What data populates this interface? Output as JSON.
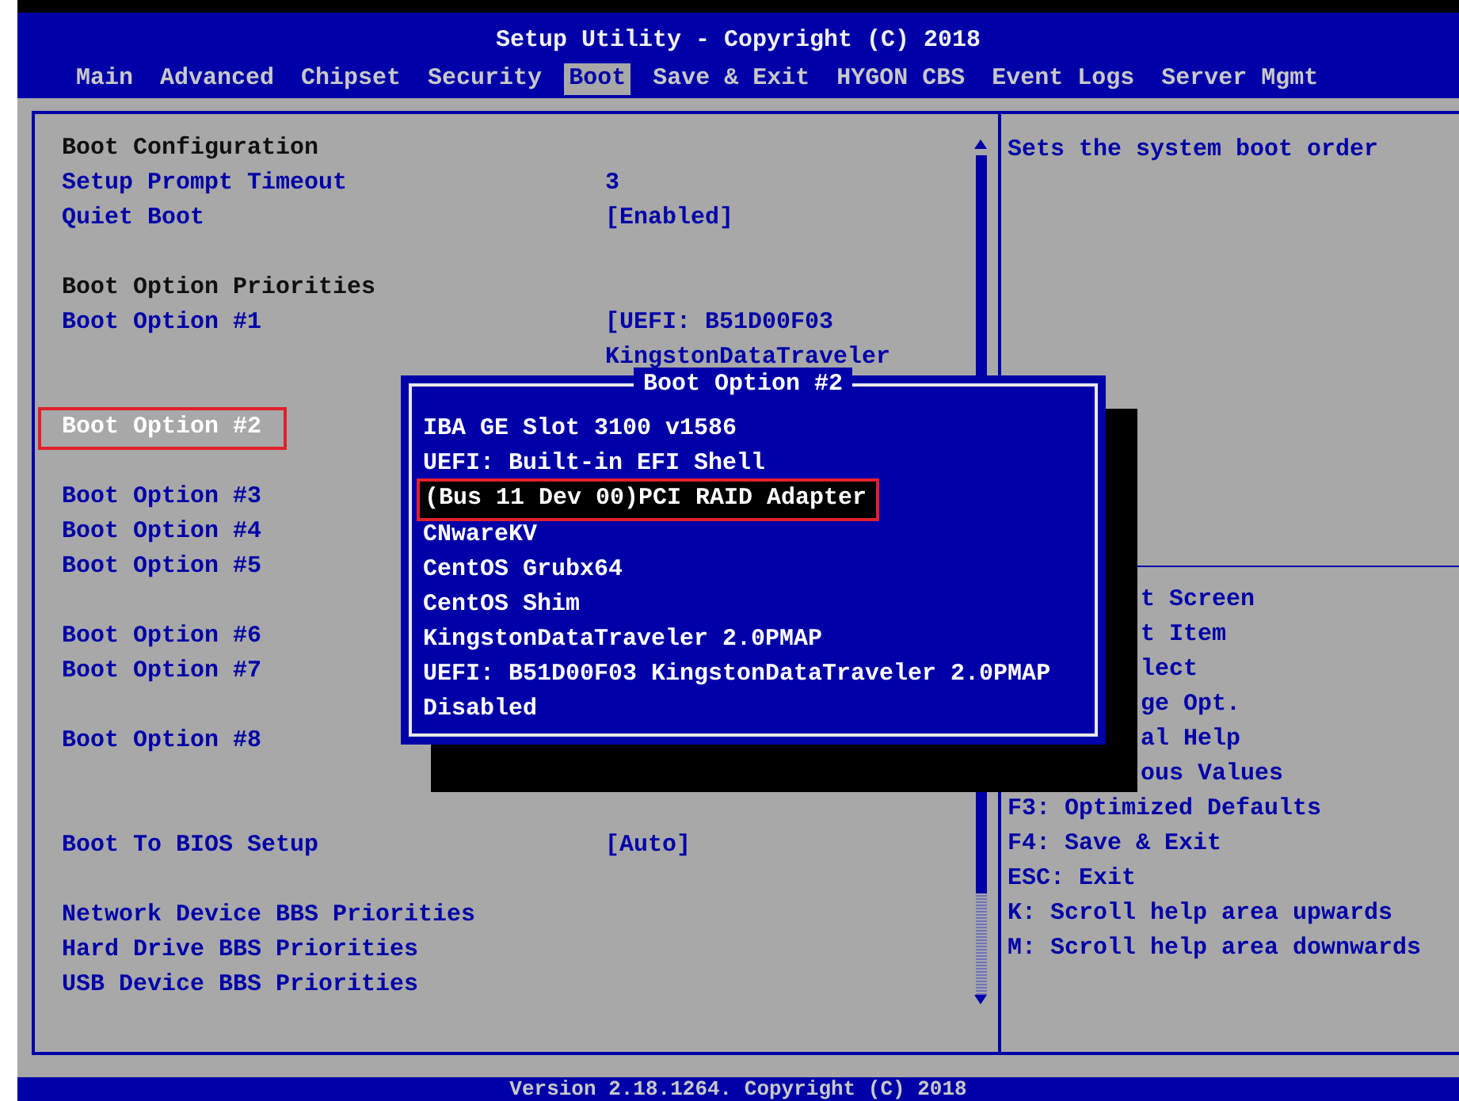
{
  "window": {
    "title": "Setup Utility - Copyright (C) 2018"
  },
  "tabs": [
    {
      "label": "Main",
      "selected": false
    },
    {
      "label": "Advanced",
      "selected": false
    },
    {
      "label": "Chipset",
      "selected": false
    },
    {
      "label": "Security",
      "selected": false
    },
    {
      "label": "Boot",
      "selected": true
    },
    {
      "label": "Save & Exit",
      "selected": false
    },
    {
      "label": "HYGON CBS",
      "selected": false
    },
    {
      "label": "Event Logs",
      "selected": false
    },
    {
      "label": "Server Mgmt",
      "selected": false
    }
  ],
  "settings": [
    {
      "kind": "heading",
      "label": "Boot Configuration"
    },
    {
      "kind": "item",
      "label": "Setup Prompt Timeout",
      "value_lines": [
        "3"
      ],
      "selected": false
    },
    {
      "kind": "item",
      "label": "Quiet Boot",
      "value_lines": [
        "[Enabled]"
      ],
      "selected": false
    },
    {
      "kind": "heading",
      "label": "Boot Option Priorities"
    },
    {
      "kind": "item",
      "label": "Boot Option #1",
      "value_lines": [
        "[UEFI: B51D00F03",
        "KingstonDataTraveler"
      ],
      "selected": false
    },
    {
      "kind": "item",
      "label": "Boot Option #2",
      "selected": true
    },
    {
      "kind": "item",
      "label": "Boot Option #3",
      "selected": false
    },
    {
      "kind": "item",
      "label": "Boot Option #4",
      "selected": false
    },
    {
      "kind": "item",
      "label": "Boot Option #5",
      "selected": false
    },
    {
      "kind": "item",
      "label": "Boot Option #6",
      "selected": false
    },
    {
      "kind": "item",
      "label": "Boot Option #7",
      "selected": false
    },
    {
      "kind": "item",
      "label": "Boot Option #8",
      "selected": false
    },
    {
      "kind": "item",
      "label": "Boot To BIOS Setup",
      "value_lines": [
        "[Auto]"
      ],
      "selected": false
    },
    {
      "kind": "item",
      "label": "Network Device BBS Priorities",
      "selected": false
    },
    {
      "kind": "item",
      "label": "Hard Drive BBS Priorities",
      "selected": false
    },
    {
      "kind": "item",
      "label": "USB Device BBS Priorities",
      "selected": false
    }
  ],
  "help": {
    "description": "Sets the system boot order",
    "keys_partial": [
      "t Screen",
      "t Item",
      "lect",
      "ge Opt.",
      "al Help",
      "ous Values"
    ],
    "keys": [
      "F3: Optimized Defaults",
      "F4: Save & Exit",
      "ESC: Exit",
      "K: Scroll help area upwards",
      "M: Scroll help area downwards"
    ]
  },
  "popup": {
    "title": "Boot Option #2",
    "options": [
      {
        "label": "IBA GE Slot 3100 v1586",
        "selected": false
      },
      {
        "label": "UEFI: Built-in EFI Shell",
        "selected": false
      },
      {
        "label": "(Bus 11 Dev 00)PCI RAID Adapter",
        "selected": true
      },
      {
        "label": "CNwareKV",
        "selected": false
      },
      {
        "label": "CentOS Grubx64",
        "selected": false
      },
      {
        "label": "CentOS Shim",
        "selected": false
      },
      {
        "label": "KingstonDataTraveler 2.0PMAP",
        "selected": false
      },
      {
        "label": "UEFI: B51D00F03 KingstonDataTraveler 2.0PMAP",
        "selected": false
      },
      {
        "label": "Disabled",
        "selected": false
      }
    ]
  },
  "status_bar": "Version 2.18.1264. Copyright (C) 2018"
}
